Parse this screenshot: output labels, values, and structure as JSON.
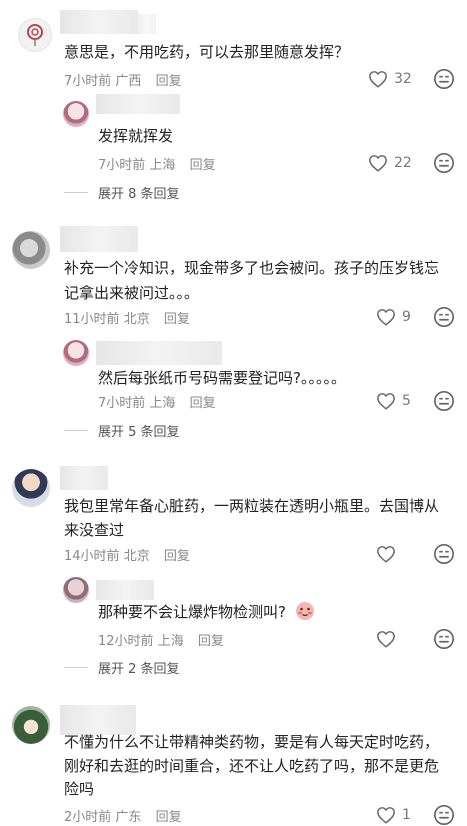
{
  "comments": [
    {
      "text": "意思是，不用吃药，可以去那里随意发挥？",
      "time": "7小时前",
      "location": "广西",
      "reply_label": "回复",
      "likes": "32",
      "replies": [
        {
          "text": "发挥就挥发",
          "time": "7小时前",
          "location": "上海",
          "reply_label": "回复",
          "likes": "22"
        }
      ],
      "expand_label": "展开 8 条回复"
    },
    {
      "text_lines": [
        "补充一个冷知识，现金带多了也会被问。孩子的压岁钱忘",
        "记拿出来被问过。。。"
      ],
      "time": "11小时前",
      "location": "北京",
      "reply_label": "回复",
      "likes": "9",
      "replies": [
        {
          "text": "然后每张纸币号码需要登记吗?。。。。。",
          "time": "7小时前",
          "location": "上海",
          "reply_label": "回复",
          "likes": "5"
        }
      ],
      "expand_label": "展开 5 条回复"
    },
    {
      "text_lines": [
        "我包里常年备心脏药，一两粒装在透明小瓶里。去国博从",
        "来没查过"
      ],
      "time": "14小时前",
      "location": "北京",
      "reply_label": "回复",
      "likes": "",
      "replies": [
        {
          "text": "那种要不会让爆炸物检测叫?",
          "time": "12小时前",
          "location": "上海",
          "reply_label": "回复",
          "likes": ""
        }
      ],
      "expand_label": "展开 2 条回复"
    },
    {
      "text_lines": [
        "不懂为什么不让带精神类药物，要是有人每天定时吃药，",
        "刚好和去逛的时间重合，还不让人吃药了吗，那不是更危",
        "险吗"
      ],
      "time": "2小时前",
      "location": "广东",
      "reply_label": "回复",
      "likes": "1"
    }
  ],
  "icons": [
    "heart-icon",
    "emoji-icon",
    "lollipop-avatar",
    "blush-emoji"
  ],
  "colors": {
    "text": "#222222",
    "meta": "#888888",
    "icon": "#666666"
  }
}
